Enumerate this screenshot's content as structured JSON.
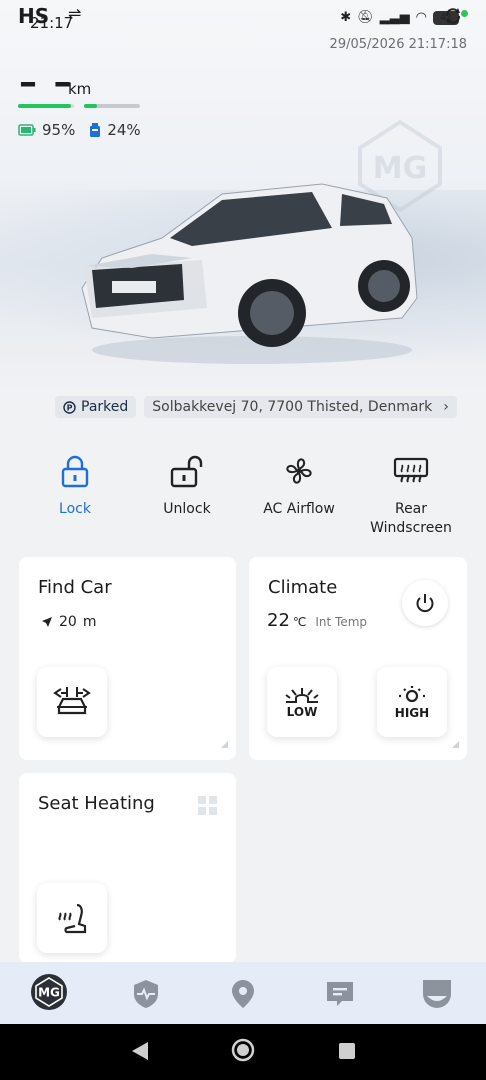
{
  "status_bar": {
    "carrier": "HS",
    "time": "21:17",
    "battery": "42",
    "timestamp": "29/05/2026 21:17:18"
  },
  "vehicle": {
    "range_value": "– –",
    "range_unit": "km",
    "battery_level": "95%",
    "fuel_level": "24%",
    "battery_fraction": 0.95,
    "fuel_fraction": 0.24
  },
  "location": {
    "status": "Parked",
    "address": "Solbakkevej 70, 7700 Thisted, Denmark"
  },
  "quick_actions": [
    {
      "label": "Lock",
      "icon": "lock-icon",
      "active": true
    },
    {
      "label": "Unlock",
      "icon": "unlock-icon",
      "active": false
    },
    {
      "label": "AC Airflow",
      "icon": "fan-icon",
      "active": false
    },
    {
      "label": "Rear\nWindscreen",
      "icon": "rear-defrost-icon",
      "active": false
    }
  ],
  "cards": {
    "find_car": {
      "title": "Find Car",
      "distance": "20",
      "distance_unit": "m"
    },
    "climate": {
      "title": "Climate",
      "temp": "22",
      "temp_unit": "℃",
      "temp_label": "Int Temp",
      "low_label": "LOW",
      "high_label": "HIGH"
    },
    "seat_heating": {
      "title": "Seat Heating"
    }
  },
  "tabs": [
    "mg-home-icon",
    "vehicle-health-icon",
    "location-icon",
    "messages-icon",
    "profile-icon"
  ],
  "colors": {
    "accent": "#1e6fd9",
    "green": "#22c55e",
    "tabbar": "#e6ecf7"
  }
}
